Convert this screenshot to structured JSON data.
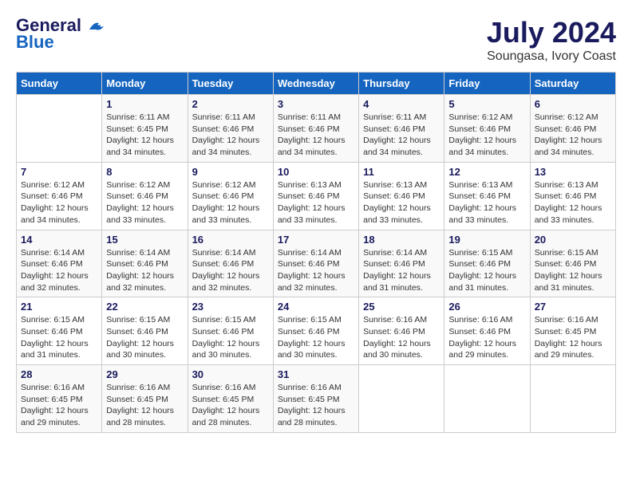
{
  "header": {
    "logo_line1": "General",
    "logo_line2": "Blue",
    "month_title": "July 2024",
    "location": "Soungasa, Ivory Coast"
  },
  "weekdays": [
    "Sunday",
    "Monday",
    "Tuesday",
    "Wednesday",
    "Thursday",
    "Friday",
    "Saturday"
  ],
  "weeks": [
    [
      {
        "day": "",
        "sunrise": "",
        "sunset": "",
        "daylight": ""
      },
      {
        "day": "1",
        "sunrise": "Sunrise: 6:11 AM",
        "sunset": "Sunset: 6:45 PM",
        "daylight": "Daylight: 12 hours and 34 minutes."
      },
      {
        "day": "2",
        "sunrise": "Sunrise: 6:11 AM",
        "sunset": "Sunset: 6:46 PM",
        "daylight": "Daylight: 12 hours and 34 minutes."
      },
      {
        "day": "3",
        "sunrise": "Sunrise: 6:11 AM",
        "sunset": "Sunset: 6:46 PM",
        "daylight": "Daylight: 12 hours and 34 minutes."
      },
      {
        "day": "4",
        "sunrise": "Sunrise: 6:11 AM",
        "sunset": "Sunset: 6:46 PM",
        "daylight": "Daylight: 12 hours and 34 minutes."
      },
      {
        "day": "5",
        "sunrise": "Sunrise: 6:12 AM",
        "sunset": "Sunset: 6:46 PM",
        "daylight": "Daylight: 12 hours and 34 minutes."
      },
      {
        "day": "6",
        "sunrise": "Sunrise: 6:12 AM",
        "sunset": "Sunset: 6:46 PM",
        "daylight": "Daylight: 12 hours and 34 minutes."
      }
    ],
    [
      {
        "day": "7",
        "sunrise": "Sunrise: 6:12 AM",
        "sunset": "Sunset: 6:46 PM",
        "daylight": "Daylight: 12 hours and 34 minutes."
      },
      {
        "day": "8",
        "sunrise": "Sunrise: 6:12 AM",
        "sunset": "Sunset: 6:46 PM",
        "daylight": "Daylight: 12 hours and 33 minutes."
      },
      {
        "day": "9",
        "sunrise": "Sunrise: 6:12 AM",
        "sunset": "Sunset: 6:46 PM",
        "daylight": "Daylight: 12 hours and 33 minutes."
      },
      {
        "day": "10",
        "sunrise": "Sunrise: 6:13 AM",
        "sunset": "Sunset: 6:46 PM",
        "daylight": "Daylight: 12 hours and 33 minutes."
      },
      {
        "day": "11",
        "sunrise": "Sunrise: 6:13 AM",
        "sunset": "Sunset: 6:46 PM",
        "daylight": "Daylight: 12 hours and 33 minutes."
      },
      {
        "day": "12",
        "sunrise": "Sunrise: 6:13 AM",
        "sunset": "Sunset: 6:46 PM",
        "daylight": "Daylight: 12 hours and 33 minutes."
      },
      {
        "day": "13",
        "sunrise": "Sunrise: 6:13 AM",
        "sunset": "Sunset: 6:46 PM",
        "daylight": "Daylight: 12 hours and 33 minutes."
      }
    ],
    [
      {
        "day": "14",
        "sunrise": "Sunrise: 6:14 AM",
        "sunset": "Sunset: 6:46 PM",
        "daylight": "Daylight: 12 hours and 32 minutes."
      },
      {
        "day": "15",
        "sunrise": "Sunrise: 6:14 AM",
        "sunset": "Sunset: 6:46 PM",
        "daylight": "Daylight: 12 hours and 32 minutes."
      },
      {
        "day": "16",
        "sunrise": "Sunrise: 6:14 AM",
        "sunset": "Sunset: 6:46 PM",
        "daylight": "Daylight: 12 hours and 32 minutes."
      },
      {
        "day": "17",
        "sunrise": "Sunrise: 6:14 AM",
        "sunset": "Sunset: 6:46 PM",
        "daylight": "Daylight: 12 hours and 32 minutes."
      },
      {
        "day": "18",
        "sunrise": "Sunrise: 6:14 AM",
        "sunset": "Sunset: 6:46 PM",
        "daylight": "Daylight: 12 hours and 31 minutes."
      },
      {
        "day": "19",
        "sunrise": "Sunrise: 6:15 AM",
        "sunset": "Sunset: 6:46 PM",
        "daylight": "Daylight: 12 hours and 31 minutes."
      },
      {
        "day": "20",
        "sunrise": "Sunrise: 6:15 AM",
        "sunset": "Sunset: 6:46 PM",
        "daylight": "Daylight: 12 hours and 31 minutes."
      }
    ],
    [
      {
        "day": "21",
        "sunrise": "Sunrise: 6:15 AM",
        "sunset": "Sunset: 6:46 PM",
        "daylight": "Daylight: 12 hours and 31 minutes."
      },
      {
        "day": "22",
        "sunrise": "Sunrise: 6:15 AM",
        "sunset": "Sunset: 6:46 PM",
        "daylight": "Daylight: 12 hours and 30 minutes."
      },
      {
        "day": "23",
        "sunrise": "Sunrise: 6:15 AM",
        "sunset": "Sunset: 6:46 PM",
        "daylight": "Daylight: 12 hours and 30 minutes."
      },
      {
        "day": "24",
        "sunrise": "Sunrise: 6:15 AM",
        "sunset": "Sunset: 6:46 PM",
        "daylight": "Daylight: 12 hours and 30 minutes."
      },
      {
        "day": "25",
        "sunrise": "Sunrise: 6:16 AM",
        "sunset": "Sunset: 6:46 PM",
        "daylight": "Daylight: 12 hours and 30 minutes."
      },
      {
        "day": "26",
        "sunrise": "Sunrise: 6:16 AM",
        "sunset": "Sunset: 6:46 PM",
        "daylight": "Daylight: 12 hours and 29 minutes."
      },
      {
        "day": "27",
        "sunrise": "Sunrise: 6:16 AM",
        "sunset": "Sunset: 6:45 PM",
        "daylight": "Daylight: 12 hours and 29 minutes."
      }
    ],
    [
      {
        "day": "28",
        "sunrise": "Sunrise: 6:16 AM",
        "sunset": "Sunset: 6:45 PM",
        "daylight": "Daylight: 12 hours and 29 minutes."
      },
      {
        "day": "29",
        "sunrise": "Sunrise: 6:16 AM",
        "sunset": "Sunset: 6:45 PM",
        "daylight": "Daylight: 12 hours and 28 minutes."
      },
      {
        "day": "30",
        "sunrise": "Sunrise: 6:16 AM",
        "sunset": "Sunset: 6:45 PM",
        "daylight": "Daylight: 12 hours and 28 minutes."
      },
      {
        "day": "31",
        "sunrise": "Sunrise: 6:16 AM",
        "sunset": "Sunset: 6:45 PM",
        "daylight": "Daylight: 12 hours and 28 minutes."
      },
      {
        "day": "",
        "sunrise": "",
        "sunset": "",
        "daylight": ""
      },
      {
        "day": "",
        "sunrise": "",
        "sunset": "",
        "daylight": ""
      },
      {
        "day": "",
        "sunrise": "",
        "sunset": "",
        "daylight": ""
      }
    ]
  ]
}
